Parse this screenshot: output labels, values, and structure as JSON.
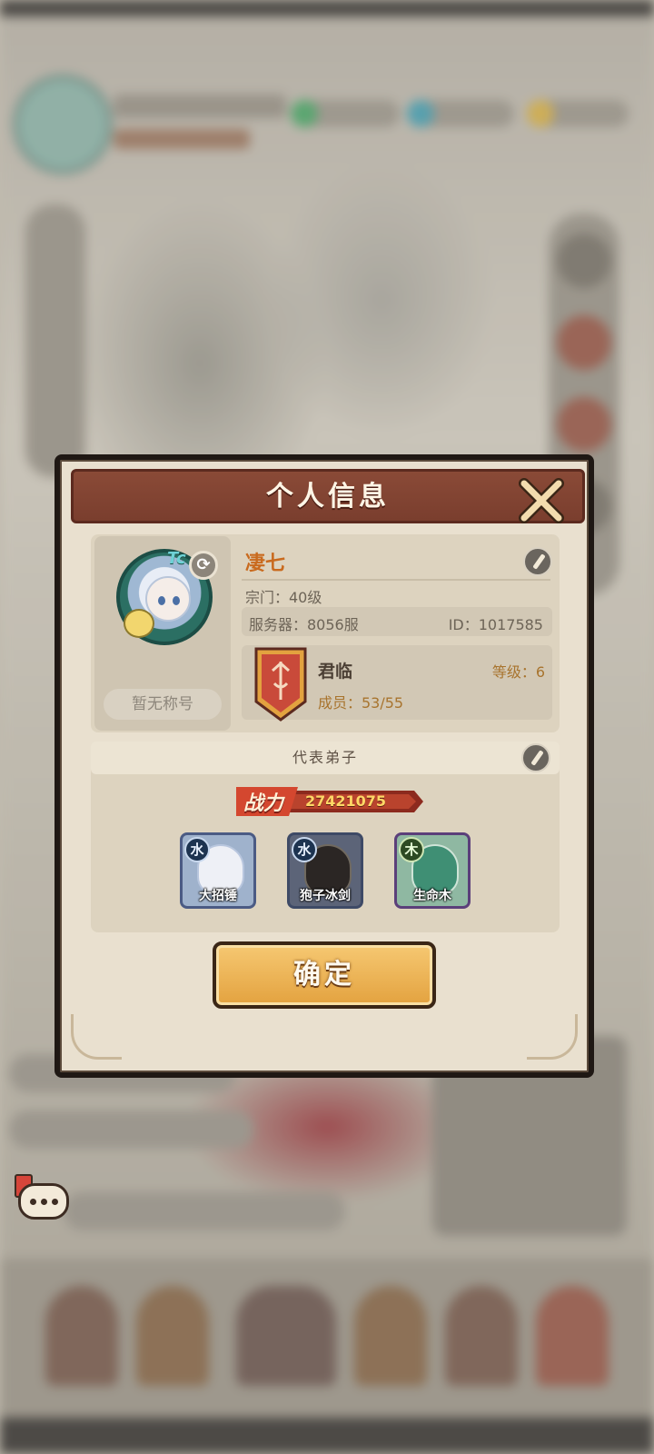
{
  "dialog": {
    "title": "个人信息"
  },
  "profile": {
    "name": "凄七",
    "sect_level": "宗门：40级",
    "server": "服务器：8056服",
    "id": "ID：1017585",
    "title_badge": "暂无称号",
    "avatar_tag": "Tc"
  },
  "guild": {
    "name": "君临",
    "level": "等级：6",
    "members": "成员：53/55"
  },
  "disciples": {
    "section_title": "代表弟子",
    "power_label": "战力",
    "power_value": "27421075",
    "heroes": [
      {
        "name": "大招锤",
        "element": "水"
      },
      {
        "name": "狍子冰剑",
        "element": "水"
      },
      {
        "name": "生命木",
        "element": "木"
      }
    ]
  },
  "buttons": {
    "confirm": "确定"
  },
  "colors": {
    "header": "#7a3e2e",
    "panel": "#e9e0cf",
    "name_orange": "#c96a1e",
    "confirm_gold": "#e3a23f",
    "guild_red": "#c94a3a"
  },
  "icons": [
    "close-icon",
    "swap-icon",
    "edit-icon",
    "guild-banner-icon",
    "chat-icon",
    "water-element-icon",
    "wood-element-icon"
  ]
}
